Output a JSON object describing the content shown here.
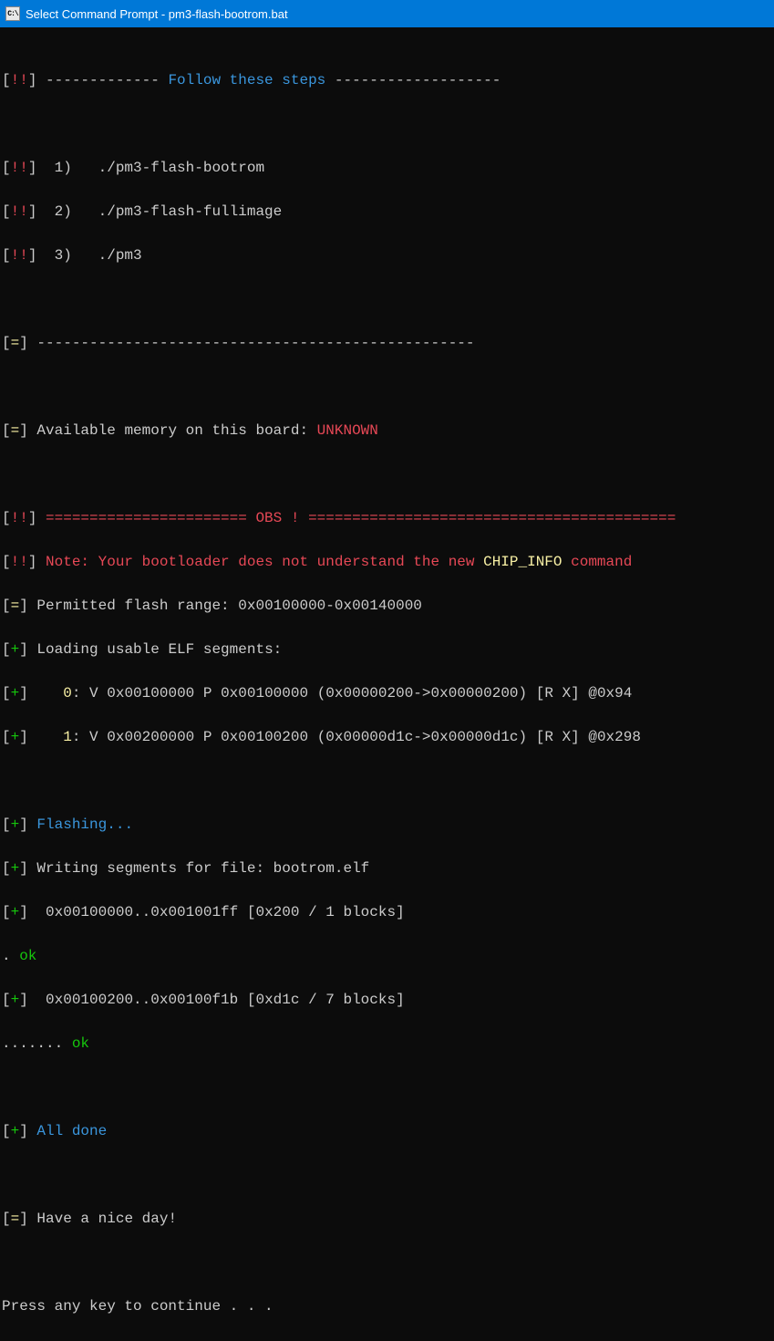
{
  "titlebar": {
    "icon_label": "C:\\",
    "title": "Select Command Prompt - pm3-flash-bootrom.bat"
  },
  "lines": {
    "l1a": "[",
    "l1b": "!!",
    "l1c": "] ------------- ",
    "l1d": "Follow these steps",
    "l1e": " -------------------",
    "l3b": "!!",
    "l3c": "]  1)   ./pm3-flash-bootrom",
    "l4b": "!!",
    "l4c": "]  2)   ./pm3-flash-fullimage",
    "l5b": "!!",
    "l5c": "]  3)   ./pm3",
    "l7b": "=",
    "l7c": "] --------------------------------------------------",
    "l9c": "] Available memory on this board: ",
    "l9d": "UNKNOWN",
    "l11b": "!!",
    "l11c": "] ",
    "l11d": "======================= OBS ! ==========================================",
    "l12b": "!!",
    "l12c": "] ",
    "l12d": "Note: Your bootloader does not understand the new ",
    "l12e": "CHIP_INFO",
    "l12f": " command",
    "l13c": "] Permitted flash range: 0x00100000-0x00140000",
    "l14b": "+",
    "l14c": "] Loading usable ELF segments:",
    "l15c": "]    ",
    "l15d": "0",
    "l15e": ": V 0x00100000 P 0x00100000 (0x00000200->0x00000200) [R X] @0x94",
    "l16c": "]    ",
    "l16d": "1",
    "l16e": ": V 0x00200000 P 0x00100200 (0x00000d1c->0x00000d1c) [R X] @0x298",
    "l18c": "] ",
    "l18d": "Flashing...",
    "l19c": "] Writing segments for file: bootrom.elf",
    "l20c": "]  0x00100000..0x001001ff [0x200 / 1 blocks]",
    "l21a": ". ",
    "l21b": "ok",
    "l22c": "]  0x00100200..0x00100f1b [0xd1c / 7 blocks]",
    "l23a": "....... ",
    "l23b": "ok",
    "l25c": "] ",
    "l25d": "All done",
    "l27c": "] Have a nice day!",
    "l29": "Press any key to continue . . ."
  }
}
